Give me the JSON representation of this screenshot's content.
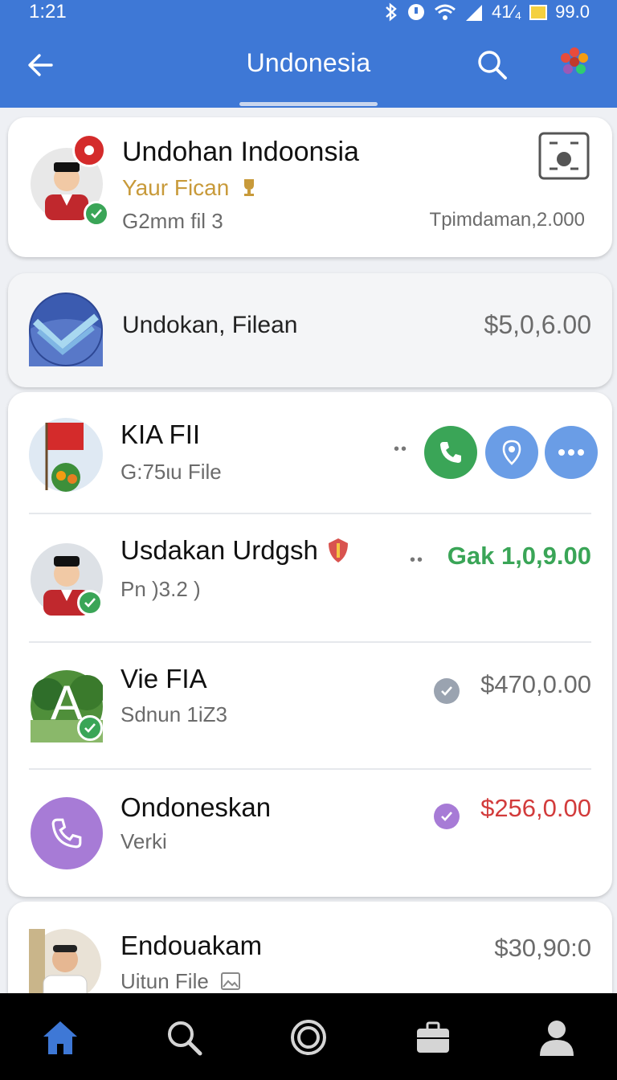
{
  "status_bar": {
    "time": "1:21",
    "battery_text": "41⁄₄",
    "battery_level_text": "99.0"
  },
  "toolbar": {
    "title": "Undonesia",
    "icons": [
      "arrow-left-icon",
      "search-icon",
      "flower-icon"
    ]
  },
  "accent_colors": {
    "app_bar": "#3e78d6",
    "green": "#3aa557",
    "blue": "#6a9de6",
    "purple": "#a77bd6",
    "red_amount": "#d23b3b",
    "gold": "#c89a3a"
  },
  "cards": {
    "featured": {
      "name": "Undohan Indoonsia",
      "highlight": "Yaur Fican",
      "detail": "G2mm fil 3",
      "meta": "Tpimdaman,2.000",
      "action_icon": "qr-scan-icon"
    },
    "summary": {
      "name": "Undokan, Filean",
      "amount": "$5,0,6.00"
    }
  },
  "list": [
    {
      "name": "KIA FII",
      "sub": "G:75ιu File",
      "dots": "••",
      "actions": [
        "phone-icon",
        "location-icon",
        "more-icon"
      ]
    },
    {
      "name": "Usdakan Urdgsh",
      "sub": "Pn )3.2 )",
      "dots": "••",
      "amount": "Gak 1,0,9.00"
    },
    {
      "name": "Vie FIA",
      "sub": "Sdnun 1iZ3",
      "avatar_letter": "A",
      "amount": "$470,0.00"
    },
    {
      "name": "Ondoneskan",
      "sub": "Verki",
      "amount": "$256,0.00"
    },
    {
      "name": "Endouakam",
      "sub": "Uitun File",
      "amount": "$30,90:0"
    }
  ],
  "bottom_nav": [
    "home-icon",
    "search-icon",
    "circle-icon",
    "briefcase-icon",
    "profile-icon"
  ]
}
